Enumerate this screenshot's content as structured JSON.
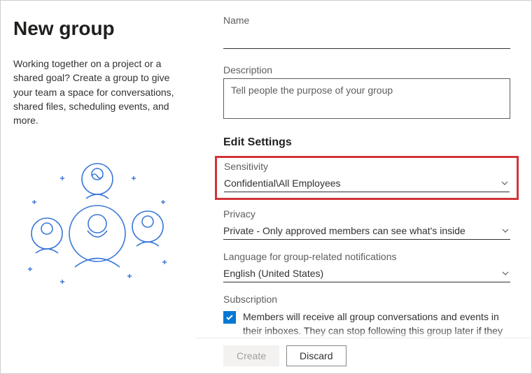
{
  "left": {
    "title": "New group",
    "description": "Working together on a project or a shared goal? Create a group to give your team a space for conversations, shared files, scheduling events, and more."
  },
  "form": {
    "name_label": "Name",
    "name_value": "",
    "description_label": "Description",
    "description_placeholder": "Tell people the purpose of your group",
    "description_value": "",
    "edit_settings_heading": "Edit Settings",
    "sensitivity_label": "Sensitivity",
    "sensitivity_value": "Confidential\\All Employees",
    "privacy_label": "Privacy",
    "privacy_value": "Private - Only approved members can see what's inside",
    "language_label": "Language for group-related notifications",
    "language_value": "English (United States)",
    "subscription_label": "Subscription",
    "subscription_checked": true,
    "subscription_text": "Members will receive all group conversations and events in their inboxes. They can stop following this group later if they"
  },
  "buttons": {
    "create": "Create",
    "discard": "Discard"
  }
}
